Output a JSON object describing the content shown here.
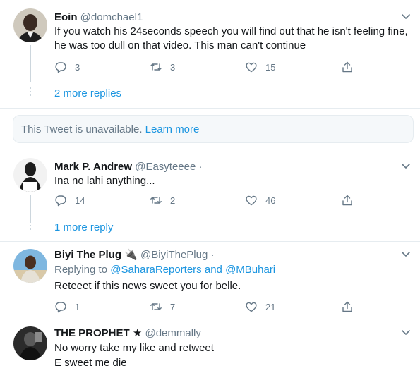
{
  "tweets": [
    {
      "name": "Eoin",
      "handle": "@domchael1",
      "text": "If you watch his 24seconds speech you will find out that he isn't feeling fine, he was too dull on that  video. This man can't continue",
      "replies": "3",
      "retweets": "3",
      "likes": "15",
      "more_replies": "2 more replies"
    },
    {
      "name": "Mark P. Andrew",
      "handle": "@Easyteeee",
      "separator": "·",
      "text": "Ina no lahi anything...",
      "replies": "14",
      "retweets": "2",
      "likes": "46",
      "more_replies": "1 more reply"
    },
    {
      "name": "Biyi The Plug",
      "name_emoji": "🔌",
      "handle": "@BiyiThePlug",
      "separator": "·",
      "replying_prefix": "Replying to",
      "replying_user1": "@SaharaReporters",
      "replying_and": "and",
      "replying_user2": "@MBuhari",
      "text": "Reteeet if this news sweet you for belle.",
      "replies": "1",
      "retweets": "7",
      "likes": "21"
    },
    {
      "name": "THE PROPHET",
      "name_star": "★",
      "handle": "@demmally",
      "text_line1": "No worry take my like and retweet",
      "text_line2": "E sweet me die"
    }
  ],
  "unavailable": {
    "text": "This Tweet is unavailable.",
    "link": "Learn more"
  },
  "colors": {
    "accent": "#1b95e0",
    "muted": "#657786",
    "border": "#e6ecf0"
  },
  "icons": [
    "reply-icon",
    "retweet-icon",
    "like-icon",
    "share-icon",
    "chevron-down-icon"
  ]
}
